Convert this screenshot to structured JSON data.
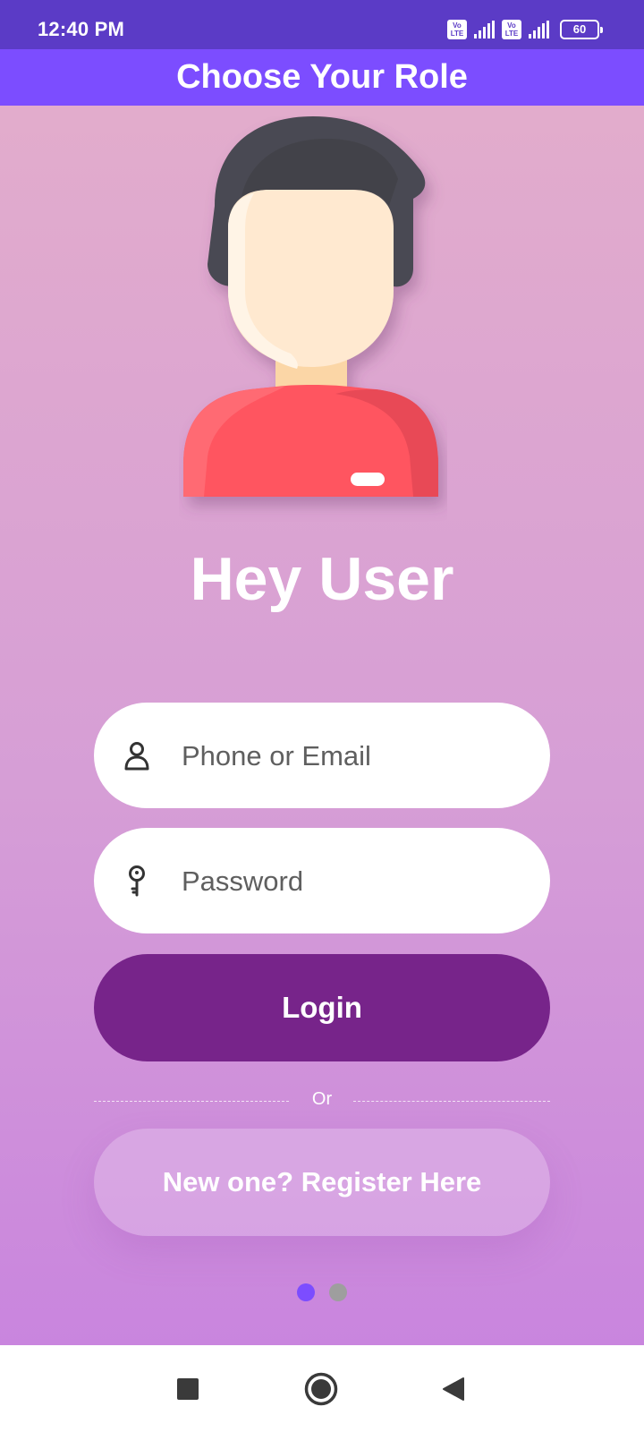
{
  "status_bar": {
    "time": "12:40 PM",
    "volte_label_top": "Vo",
    "volte_label_bottom": "LTE",
    "battery": "60",
    "icons": [
      "volte-icon",
      "signal-icon",
      "volte-icon",
      "signal-icon",
      "battery-icon"
    ]
  },
  "app_bar": {
    "title": "Choose Your Role"
  },
  "main": {
    "greeting": "Hey User",
    "phone_field": {
      "placeholder": "Phone or Email",
      "value": "",
      "icon": "person-icon"
    },
    "password_field": {
      "placeholder": "Password",
      "value": "",
      "icon": "key-icon"
    },
    "login_label": "Login",
    "divider_label": "Or",
    "register_label": "New one? Register Here"
  },
  "pager": {
    "current_page": 1,
    "page_count": 2,
    "active_color": "#7c4dff",
    "inactive_color": "#9e9e9e"
  },
  "nav_bar": {
    "buttons": [
      "recents-square-icon",
      "home-circle-icon",
      "back-triangle-icon"
    ]
  },
  "colors": {
    "status_bar": "#5b3bc6",
    "app_bar": "#7c4dff",
    "login_button": "#77248a",
    "background_top": "#e2accc",
    "background_bottom": "#c985de"
  }
}
